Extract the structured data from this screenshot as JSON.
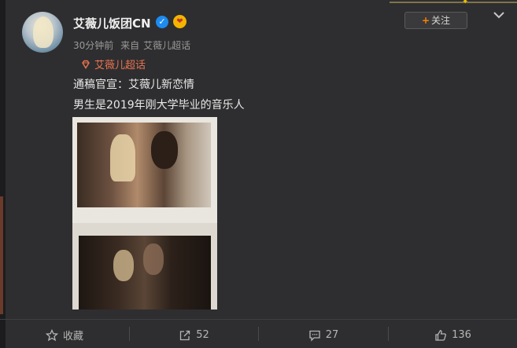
{
  "post": {
    "username": "艾薇儿饭团CN",
    "verified_icon": "verified-badge-icon",
    "vip_icon": "vip-emblem-icon",
    "time": "30分钟前",
    "source_prefix": "来自",
    "source": "艾薇儿超话",
    "follow_label": "关注",
    "topic": "艾薇儿超话",
    "text_line1": "通稿官宣：艾薇儿新恋情",
    "text_line2": "男生是2019年刚大学毕业的音乐人"
  },
  "actions": {
    "favorite_label": "收藏",
    "repost_count": "52",
    "comment_count": "27",
    "like_count": "136"
  },
  "colors": {
    "background": "#2e2e30",
    "accent_orange": "#ff8200",
    "topic_color": "#eb7350",
    "verified_blue": "#1d8bf0"
  }
}
